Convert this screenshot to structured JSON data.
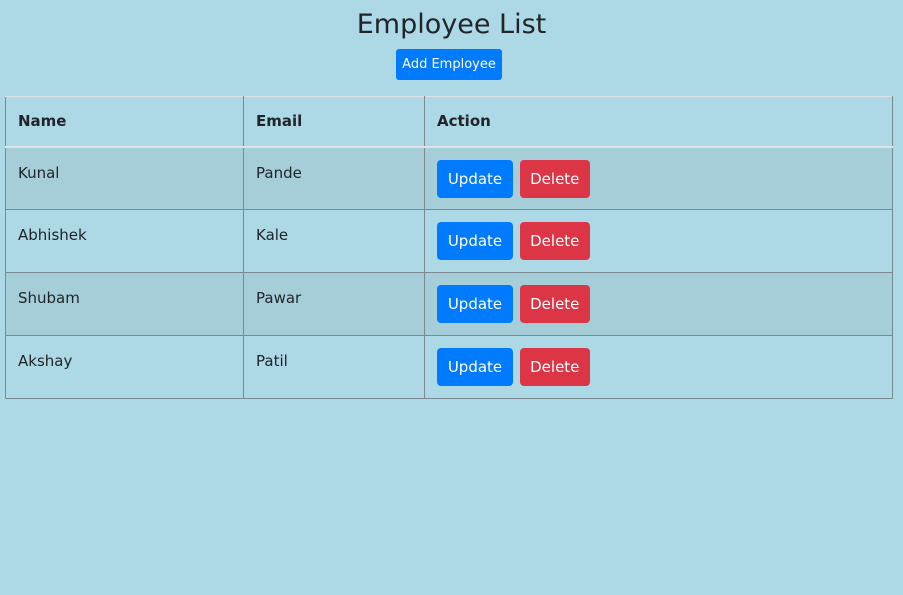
{
  "page": {
    "title": "Employee List",
    "add_button_label": "Add Employee"
  },
  "table": {
    "headers": {
      "name": "Name",
      "email": "Email",
      "action": "Action"
    },
    "update_label": "Update",
    "delete_label": "Delete",
    "rows": [
      {
        "name": "Kunal",
        "email": "Pande"
      },
      {
        "name": "Abhishek",
        "email": "Kale"
      },
      {
        "name": "Shubam",
        "email": "Pawar"
      },
      {
        "name": "Akshay",
        "email": "Patil"
      }
    ]
  },
  "colors": {
    "background": "#add8e6",
    "primary": "#007bff",
    "danger": "#dc3545"
  }
}
